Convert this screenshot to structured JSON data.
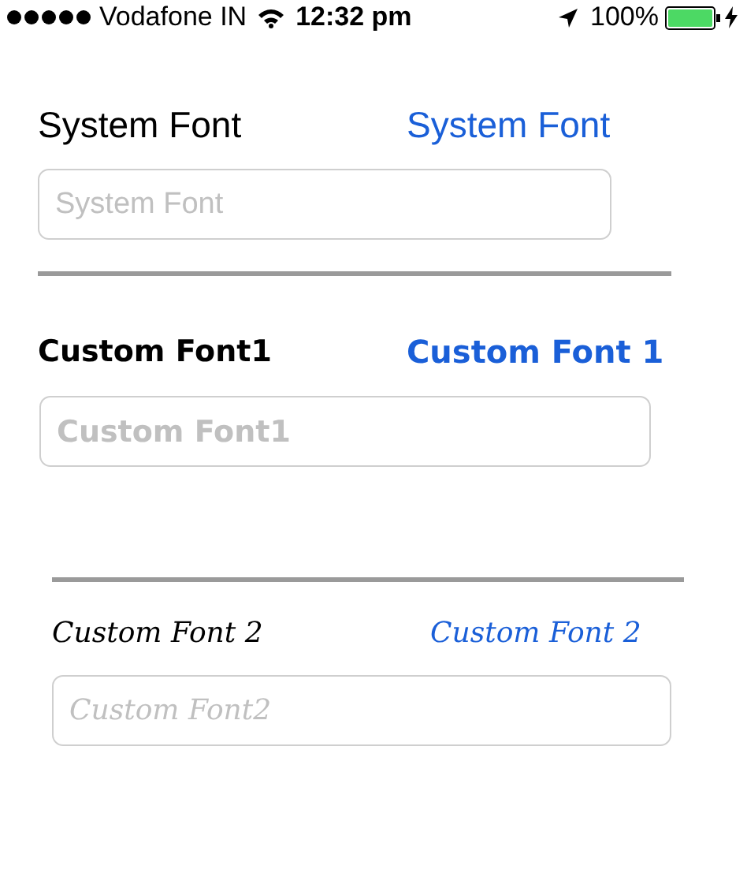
{
  "status_bar": {
    "carrier": "Vodafone IN",
    "time": "12:32 pm",
    "battery": "100%"
  },
  "sections": [
    {
      "kind": "system",
      "label": "System Font",
      "button": "System Font",
      "placeholder": "System Font"
    },
    {
      "kind": "bold",
      "label": "Custom Font1",
      "button": "Custom Font 1",
      "placeholder": "Custom Font1"
    },
    {
      "kind": "script",
      "label": "Custom Font 2",
      "button": "Custom Font 2",
      "placeholder": "Custom Font2"
    }
  ]
}
